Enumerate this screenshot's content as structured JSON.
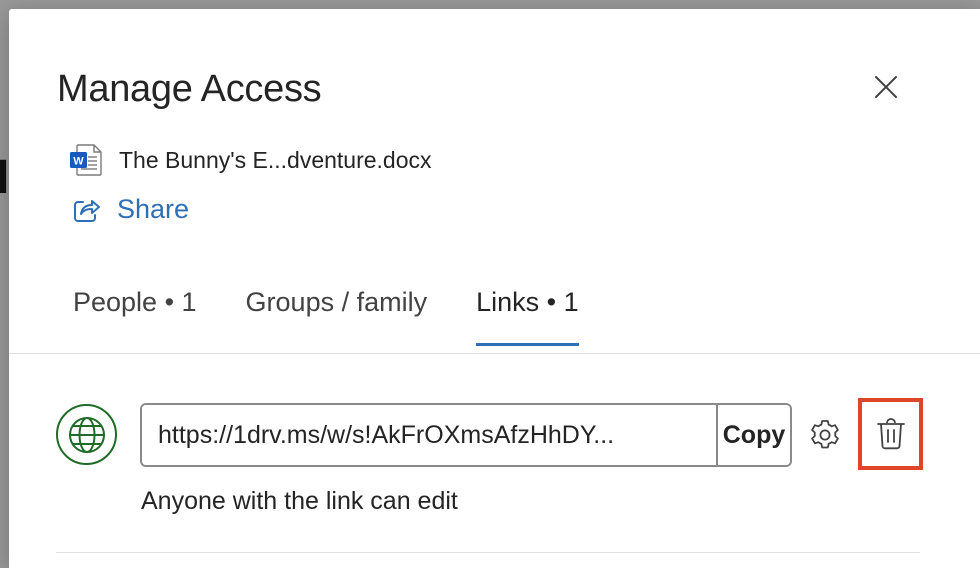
{
  "dialog": {
    "title": "Manage Access",
    "close_icon": "close-icon"
  },
  "file": {
    "icon": "word-document-icon",
    "name": "The Bunny's E...dventure.docx"
  },
  "share": {
    "icon": "share-icon",
    "label": "Share"
  },
  "tabs": [
    {
      "label": "People • 1",
      "active": false
    },
    {
      "label": "Groups / family",
      "active": false
    },
    {
      "label": "Links • 1",
      "active": true
    }
  ],
  "link": {
    "icon": "globe-icon",
    "url": "https://1drv.ms/w/s!AkFrOXmsAfzHhDY...",
    "copy_label": "Copy",
    "settings_icon": "gear-icon",
    "delete_icon": "trash-icon",
    "description": "Anyone with the link can edit"
  },
  "colors": {
    "accent": "#2f6fb5",
    "globe": "#1f6b27",
    "highlight": "#e0442a",
    "word_blue": "#185abd"
  }
}
